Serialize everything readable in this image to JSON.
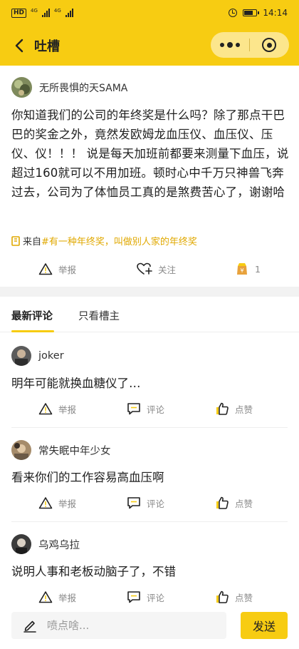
{
  "status_bar": {
    "hd_badge": "HD",
    "sim1_label": "4G",
    "sim2_label": "4G",
    "time": "14:14"
  },
  "nav": {
    "title": "吐槽"
  },
  "post": {
    "author": "无所畏惧的天SAMA",
    "content": "你知道我们的公司的年终奖是什么吗？除了那点干巴巴的奖金之外，竟然发欧姆龙血压仪、血压仪、压仪、仪！！！ 说是每天加班前都要来测量下血压，说超过160就可以不用加班。顿时心中千万只神兽飞奔过去，公司为了体恤员工真的是煞费苦心了，谢谢哈",
    "from_prefix": "来自",
    "topic": "#有一种年终奖，叫做别人家的年终奖",
    "actions": {
      "report": "举报",
      "follow": "关注",
      "reward_count": "1"
    }
  },
  "tabs": [
    {
      "label": "最新评论"
    },
    {
      "label": "只看槽主"
    }
  ],
  "comments": [
    {
      "author": "joker",
      "text": "明年可能就换血糖仪了…",
      "report": "举报",
      "comment": "评论",
      "like": "点赞"
    },
    {
      "author": "常失眠中年少女",
      "text": "看来你们的工作容易高血压啊",
      "report": "举报",
      "comment": "评论",
      "like": "点赞"
    },
    {
      "author": "乌鸡乌拉",
      "text": "说明人事和老板动脑子了，不错",
      "report": "举报",
      "comment": "评论",
      "like": "点赞"
    }
  ],
  "composer": {
    "placeholder": "喷点啥...",
    "send_label": "发送"
  },
  "colors": {
    "brand_yellow": "#f7cc12",
    "topic_link": "#e0a800"
  }
}
